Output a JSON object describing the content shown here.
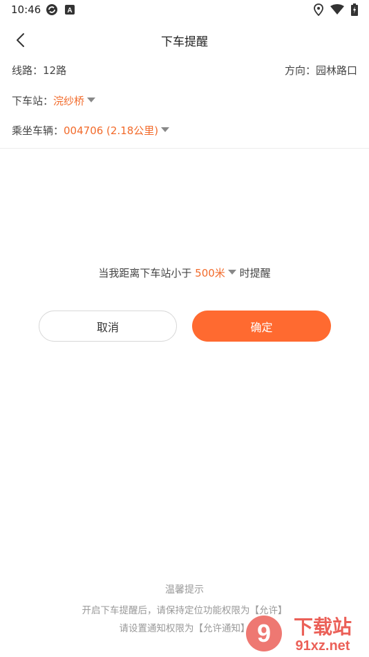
{
  "status_bar": {
    "time": "10:46",
    "icons_left": [
      "sync-icon",
      "a-badge-icon"
    ],
    "icons_right": [
      "location-icon",
      "wifi-icon",
      "battery-icon"
    ]
  },
  "nav": {
    "title": "下车提醒",
    "back_icon": "chevron-left-icon"
  },
  "route": {
    "label": "线路：",
    "value": "12路"
  },
  "direction": {
    "label": "方向：",
    "value": "园林路口"
  },
  "stop": {
    "label": "下车站：",
    "value": "浣纱桥"
  },
  "vehicle": {
    "label": "乘坐车辆：",
    "value": "004706 (2.18公里)"
  },
  "remind": {
    "prefix": "当我距离下车站小于",
    "distance": "500米",
    "suffix": "时提醒"
  },
  "buttons": {
    "cancel": "取消",
    "confirm": "确定"
  },
  "tips": {
    "title": "温馨提示",
    "line1": "开启下车提醒后，请保持定位功能权限为【允许】",
    "line2": "请设置通知权限为【允许通知】"
  },
  "watermark": {
    "logo_text": "下载站",
    "site": "91xz.net",
    "logo_number": "9"
  },
  "colors": {
    "accent": "#ff6a30",
    "accent_text": "#f26a2a",
    "tip_text": "#999999"
  }
}
